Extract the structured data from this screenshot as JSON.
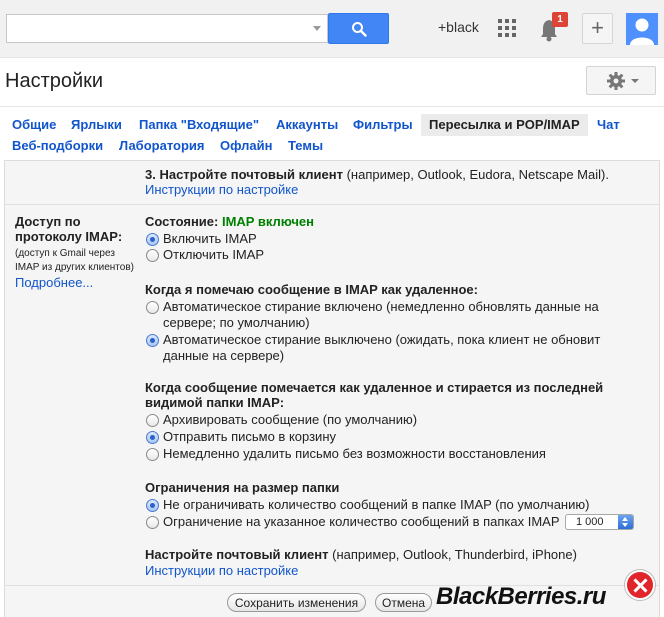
{
  "topbar": {
    "search_value": "",
    "user_label": "+black",
    "notifications_count": "1"
  },
  "header": {
    "title": "Настройки"
  },
  "tabs": [
    {
      "label": "Общие"
    },
    {
      "label": "Ярлыки"
    },
    {
      "label": "Папка \"Входящие\""
    },
    {
      "label": "Аккаунты"
    },
    {
      "label": "Фильтры"
    },
    {
      "label": "Пересылка и POP/IMAP",
      "active": true
    },
    {
      "label": "Чат"
    },
    {
      "label": "Веб-подборки"
    },
    {
      "label": "Лаборатория"
    },
    {
      "label": "Офлайн"
    },
    {
      "label": "Темы"
    }
  ],
  "pop_section": {
    "step3_bold": "3. Настройте почтовый клиент",
    "step3_rest": " (например, Outlook, Eudora, Netscape Mail).",
    "instructions_link": "Инструкции по настройке"
  },
  "imap": {
    "label_line1": "Доступ по",
    "label_line2": "протоколу IMAP:",
    "note_line1": "(доступ к Gmail через",
    "note_line2": "IMAP из других клиентов)",
    "more_link": "Подробнее...",
    "status_label": "Состояние: ",
    "status_value": "IMAP включен",
    "enable": "Включить IMAP",
    "disable": "Отключить IMAP",
    "deleted_title": "Когда я помечаю сообщение в IMAP как удаленное:",
    "auto_on_line1": "Автоматическое стирание включено (немедленно обновлять данные на",
    "auto_on_line2": "сервере; по умолчанию)",
    "auto_off_line1": "Автоматическое стирание выключено (ожидать, пока клиент не обновит",
    "auto_off_line2": "данные на сервере)",
    "expunge_title_line1": "Когда сообщение помечается как удаленное и стирается из последней",
    "expunge_title_line2": "видимой папки IMAP:",
    "archive": "Архивировать сообщение (по умолчанию)",
    "trash": "Отправить письмо в корзину",
    "delete_forever": "Немедленно удалить письмо без возможности восстановления",
    "limits_title": "Ограничения на размер папки",
    "no_limit": "Не ограничивать количество сообщений в папке IMAP (по умолчанию)",
    "limit": "Ограничение на указанное количество сообщений в папках IMAP",
    "limit_value": "1 000",
    "client_bold": "Настройте почтовый клиент",
    "client_rest": " (например, Outlook, Thunderbird, iPhone)",
    "client_link": "Инструкции по настройке"
  },
  "footer": {
    "save": "Сохранить изменения",
    "cancel": "Отмена"
  },
  "watermark": "BlackBerries.ru",
  "colors": {
    "link": "#1155cc",
    "accent": "#4285f4",
    "status_green": "#008000",
    "badge": "#db4437"
  }
}
